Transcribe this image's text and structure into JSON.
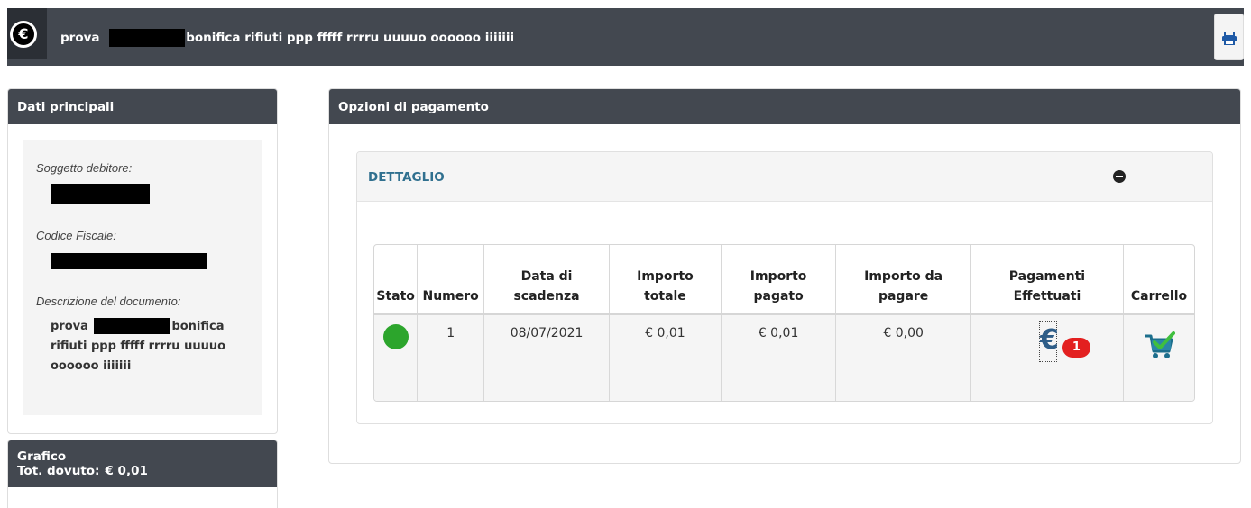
{
  "header": {
    "currency_symbol": "€",
    "title_prefix": "prova",
    "title_suffix": "bonifica rifiuti ppp fffff rrrru uuuuo oooooo iiiiiii",
    "print_icon": "print-icon"
  },
  "main_panel": {
    "title": "Dati principali",
    "debtor_label": "Soggetto debitore:",
    "tax_code_label": "Codice Fiscale:",
    "description_label": "Descrizione del documento:",
    "description_prefix": "prova",
    "description_suffix": "bonifica rifiuti ppp fffff rrrru uuuuo oooooo iiiiiii"
  },
  "chart_panel": {
    "title": "Grafico",
    "total_label": "Tot. dovuto:",
    "total_value": "€ 0,01"
  },
  "payment_panel": {
    "title": "Opzioni di pagamento",
    "detail_title": "DETTAGLIO",
    "columns": [
      "Stato",
      "Numero",
      "Data di scadenza",
      "Importo totale",
      "Importo pagato",
      "Importo da pagare",
      "Pagamenti Effettuati",
      "Carrello"
    ],
    "rows": [
      {
        "status": "green",
        "number": "1",
        "due_date": "08/07/2021",
        "total": "€ 0,01",
        "paid": "€ 0,01",
        "to_pay": "€ 0,00",
        "payments_icon": "€",
        "payments_count": "1"
      }
    ]
  },
  "colors": {
    "header_bg": "#434850",
    "accent_blue": "#30708f",
    "status_green": "#2ca52c",
    "badge_red": "#e32020"
  }
}
